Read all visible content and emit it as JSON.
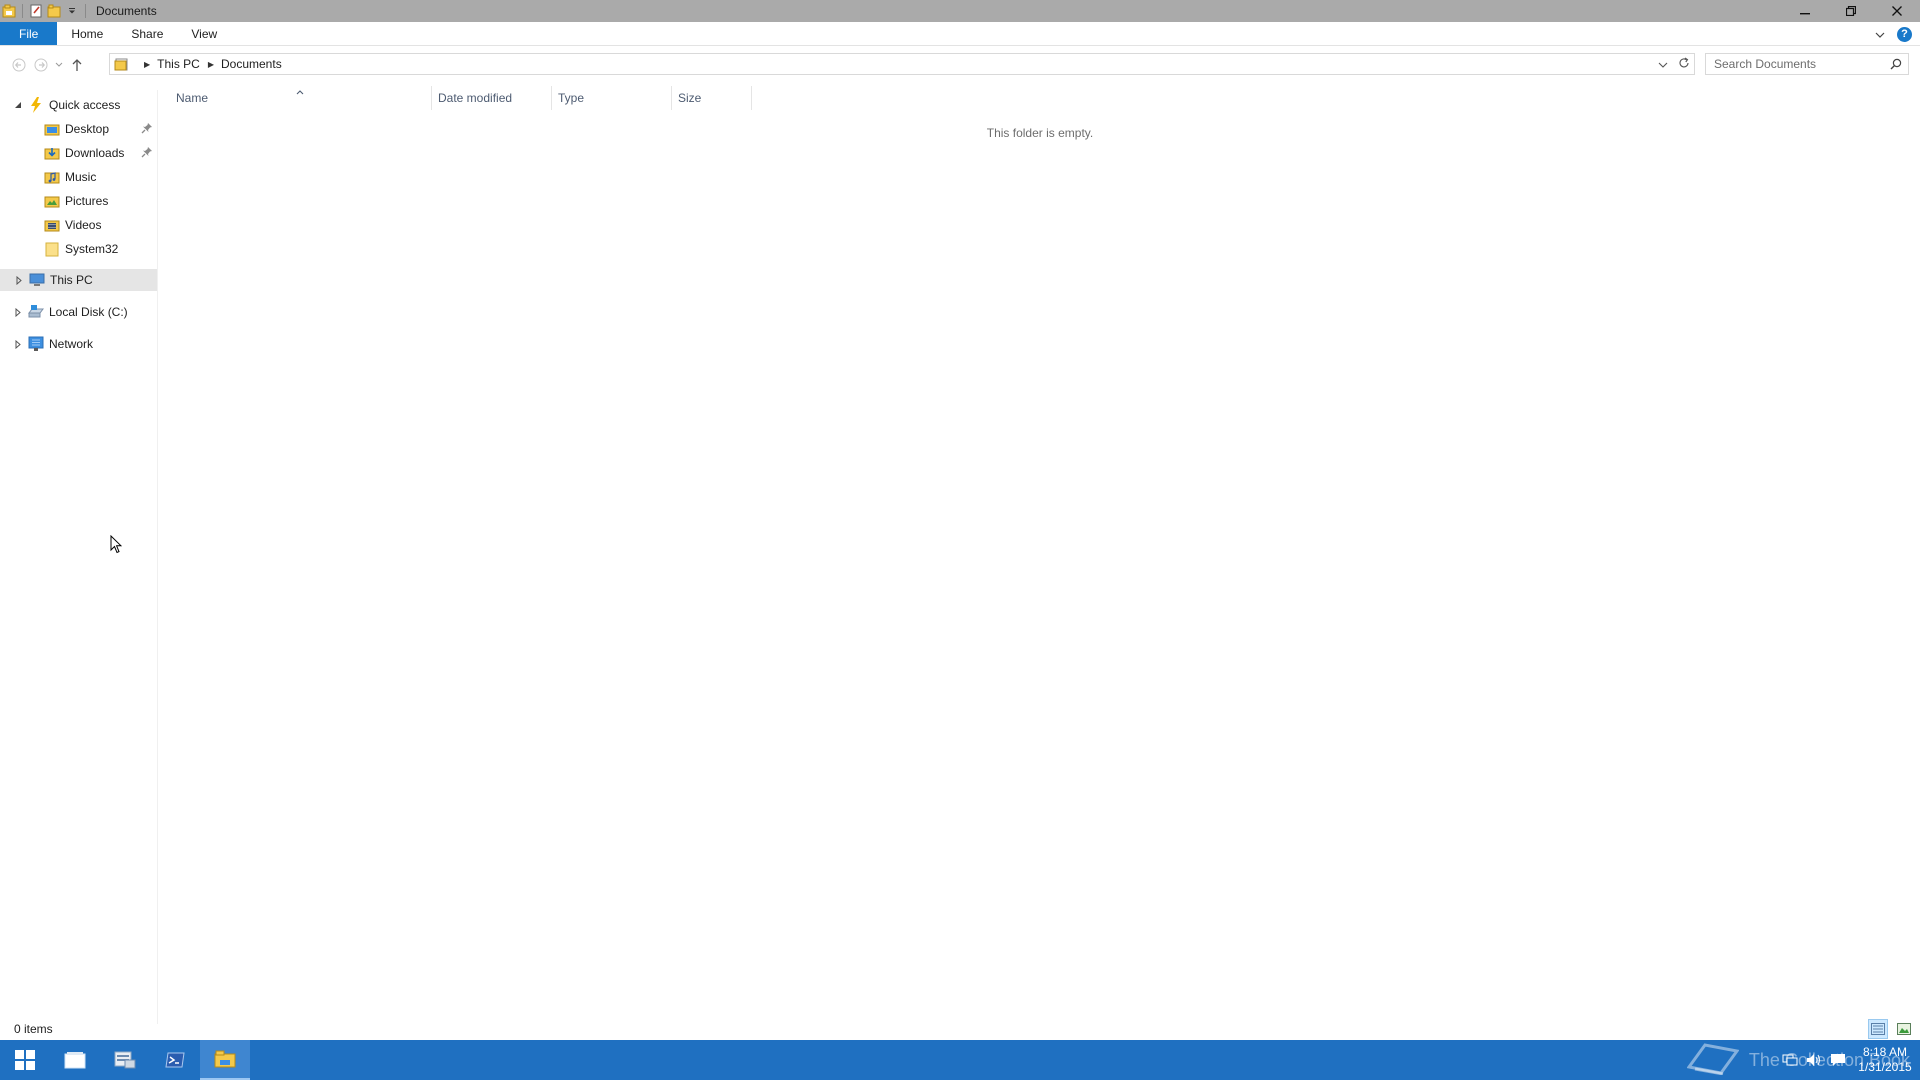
{
  "window": {
    "title": "Documents"
  },
  "ribbon": {
    "tabs": [
      "File",
      "Home",
      "Share",
      "View"
    ]
  },
  "address": {
    "crumbs": [
      "This PC",
      "Documents"
    ]
  },
  "search": {
    "placeholder": "Search Documents"
  },
  "nav": {
    "quick_access": "Quick access",
    "quick_items": [
      {
        "label": "Desktop",
        "icon": "desktop-folder-icon",
        "pinned": true
      },
      {
        "label": "Downloads",
        "icon": "downloads-folder-icon",
        "pinned": true
      },
      {
        "label": "Music",
        "icon": "music-folder-icon",
        "pinned": false
      },
      {
        "label": "Pictures",
        "icon": "pictures-folder-icon",
        "pinned": false
      },
      {
        "label": "Videos",
        "icon": "videos-folder-icon",
        "pinned": false
      },
      {
        "label": "System32",
        "icon": "folder-icon",
        "pinned": false
      }
    ],
    "this_pc": "This PC",
    "local_disk": "Local Disk (C:)",
    "network": "Network"
  },
  "file_list": {
    "columns": [
      "Name",
      "Date modified",
      "Type",
      "Size"
    ],
    "sorted_by": "Name",
    "empty_message": "This folder is empty."
  },
  "status": {
    "item_count": "0 items"
  },
  "taskbar": {
    "time": "8:18 AM",
    "date": "1/31/2015",
    "watermark": "The Collection Book"
  },
  "colors": {
    "accent": "#1979ca",
    "taskbar": "#1f70c1",
    "titlebar": "#aaaaaa",
    "selected_nav": "#e5e5e5"
  }
}
